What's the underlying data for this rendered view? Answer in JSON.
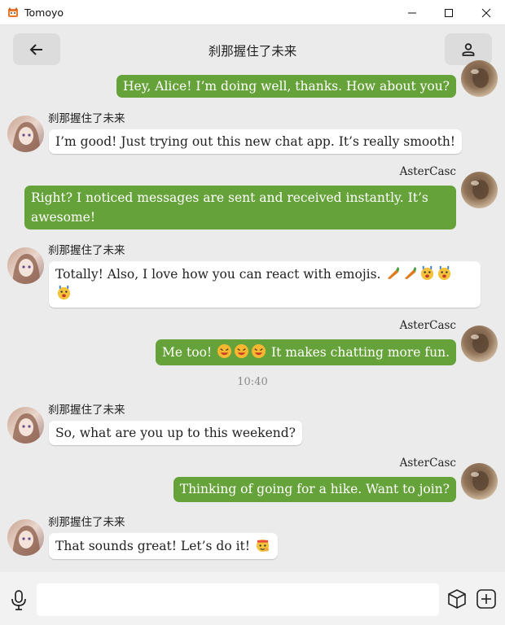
{
  "window": {
    "title": "Tomoyo",
    "minimize_glyph": "—",
    "maximize_glyph": "☐",
    "close_glyph": "✕"
  },
  "header": {
    "title": "刹那握住了未来",
    "back_icon": "arrow-left-icon",
    "profile_icon": "person-icon"
  },
  "participants": {
    "me": "AsterCasc",
    "other": "刹那握住了未来"
  },
  "messages": [
    {
      "direction": "out",
      "sender": "",
      "text": "Hey, Alice! I’m doing well, thanks. How about you?"
    },
    {
      "direction": "in",
      "sender": "刹那握住了未来",
      "text": "I’m good! Just trying out this new chat app. It’s really smooth!"
    },
    {
      "direction": "out",
      "sender": "AsterCasc",
      "text": "Right? I noticed messages are sent and received instantly. It’s awesome!"
    },
    {
      "direction": "in",
      "sender": "刹那握住了未来",
      "text": "Totally! Also, I love how you can react with emojis.",
      "emojis": [
        "carrot",
        "carrot",
        "surprised-face",
        "surprised-face",
        "surprised-face"
      ]
    },
    {
      "direction": "out",
      "sender": "AsterCasc",
      "text_before": "Me too!",
      "emojis": [
        "laughing-face",
        "laughing-face",
        "laughing-face"
      ],
      "text_after": "It makes chatting more fun."
    },
    {
      "direction": "in",
      "sender": "刹那握住了未来",
      "text": "So, what are you up to this weekend?"
    },
    {
      "direction": "out",
      "sender": "AsterCasc",
      "text": "Thinking of going for a hike. Want to join?"
    },
    {
      "direction": "in",
      "sender": "刹那握住了未来",
      "text": "That sounds great! Let’s do it!",
      "emojis": [
        "saluting-face"
      ]
    }
  ],
  "timestamp": "10:40",
  "input": {
    "value": "",
    "placeholder": ""
  },
  "colors": {
    "outgoing_bubble": "#66a23a",
    "incoming_bubble": "#ffffff",
    "background": "#ebebeb",
    "button_bg": "#dcdcdc"
  }
}
